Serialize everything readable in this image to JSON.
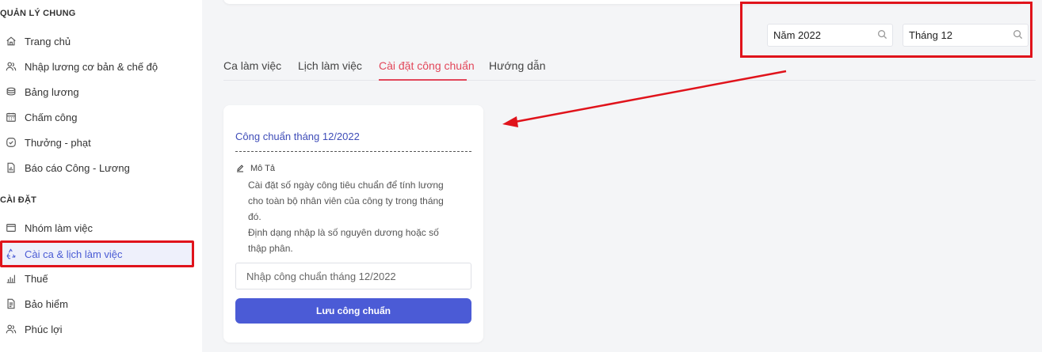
{
  "sidebar": {
    "section_general": "QUẢN LÝ CHUNG",
    "section_settings": "CÀI ĐẶT",
    "general_items": [
      {
        "label": "Trang chủ",
        "icon": "home-icon"
      },
      {
        "label": "Nhập lương cơ bản & chế độ",
        "icon": "users-icon"
      },
      {
        "label": "Bảng lương",
        "icon": "coins-icon"
      },
      {
        "label": "Chấm công",
        "icon": "calendar-icon"
      },
      {
        "label": "Thưởng - phạt",
        "icon": "check-circle-icon"
      },
      {
        "label": "Báo cáo Công - Lương",
        "icon": "report-icon"
      }
    ],
    "settings_items": [
      {
        "label": "Nhóm làm việc",
        "icon": "folder-icon"
      },
      {
        "label": "Cài ca & lịch làm việc",
        "icon": "recycle-icon",
        "active": true
      },
      {
        "label": "Thuế",
        "icon": "bar-chart-icon"
      },
      {
        "label": "Bảo hiểm",
        "icon": "document-icon"
      },
      {
        "label": "Phúc lợi",
        "icon": "users-icon"
      }
    ]
  },
  "filters": {
    "year": "Năm 2022",
    "month": "Tháng 12"
  },
  "tabs": [
    {
      "label": "Ca làm việc"
    },
    {
      "label": "Lịch làm việc"
    },
    {
      "label": "Cài đặt công chuẩn",
      "active": true
    },
    {
      "label": "Hướng dẫn"
    }
  ],
  "card": {
    "title": "Công chuẩn tháng 12/2022",
    "desc_heading": "Mô Tả",
    "desc_lines": [
      "Cài đặt số ngày công tiêu chuẩn để tính lương",
      "cho toàn bộ nhân viên của công ty trong tháng",
      "đó.",
      "Định dạng nhập là số nguyên dương hoặc số",
      "thập phân."
    ],
    "input_placeholder": "Nhập công chuẩn tháng 12/2022",
    "save_label": "Lưu công chuẩn"
  },
  "colors": {
    "accent": "#4b5bd6",
    "active_tab": "#e2475a",
    "annotation": "#e0131b"
  }
}
